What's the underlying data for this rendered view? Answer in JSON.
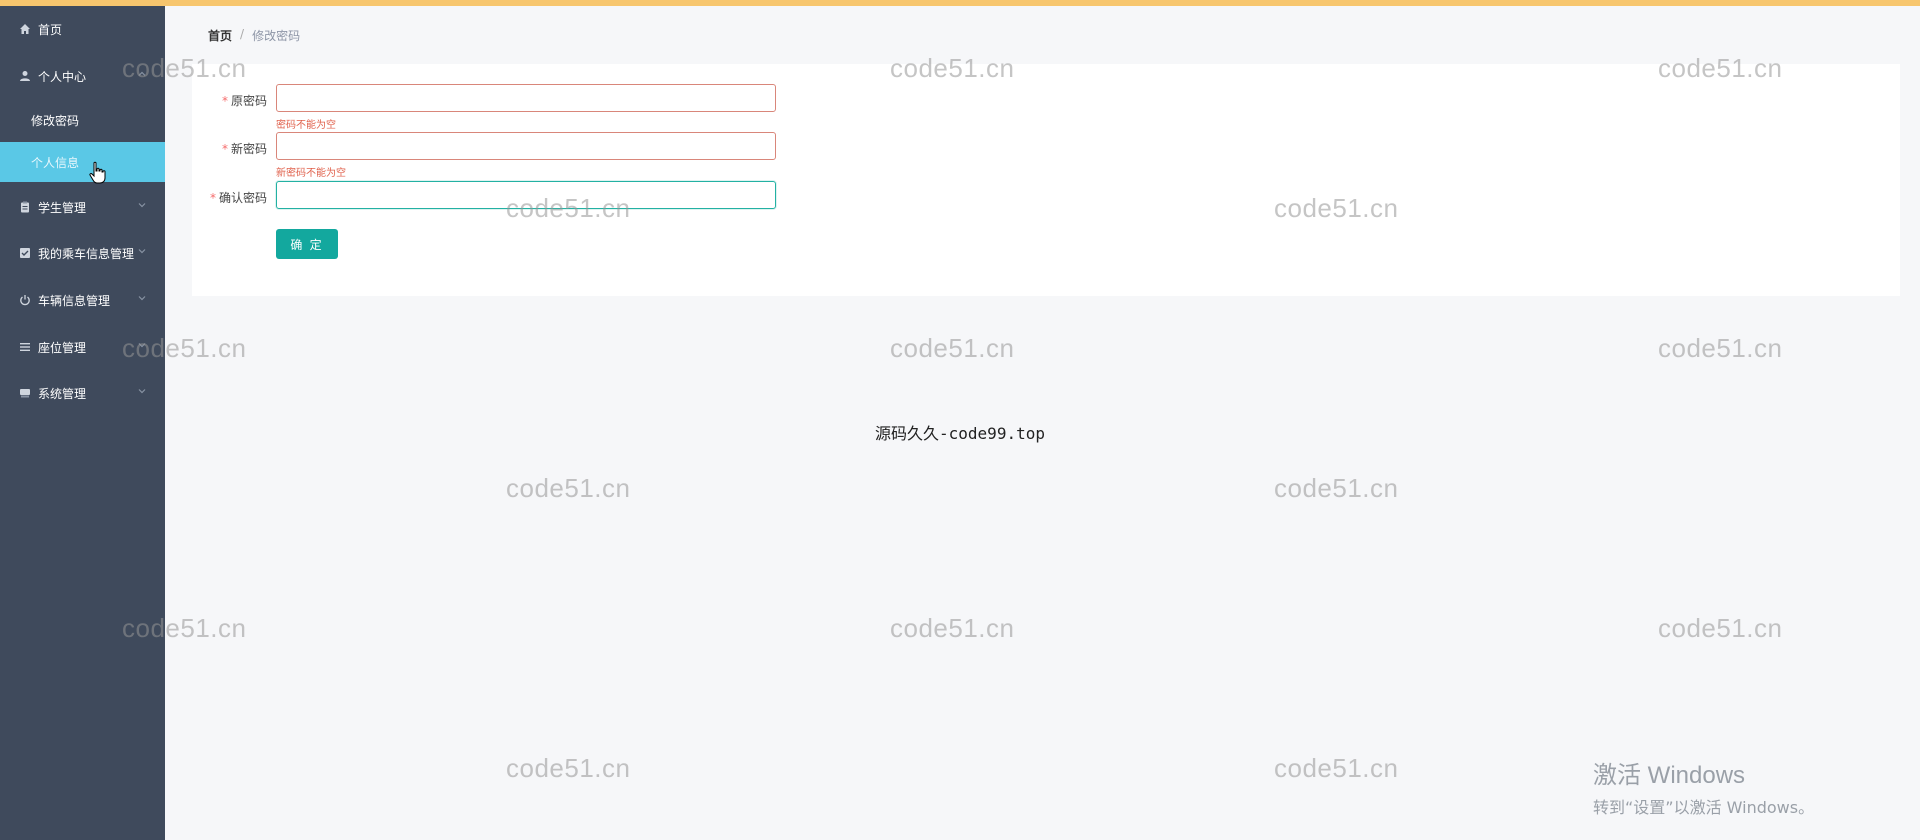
{
  "sidebar": {
    "items": [
      {
        "label": "首页",
        "icon": "home-icon"
      },
      {
        "label": "个人中心",
        "icon": "user-icon"
      },
      {
        "label": "学生管理",
        "icon": "clipboard-icon"
      },
      {
        "label": "我的乘车信息管理",
        "icon": "checkbox-icon"
      },
      {
        "label": "车辆信息管理",
        "icon": "power-icon"
      },
      {
        "label": "座位管理",
        "icon": "list-icon"
      },
      {
        "label": "系统管理",
        "icon": "drawer-icon"
      }
    ],
    "sub_items": [
      {
        "label": "修改密码"
      },
      {
        "label": "个人信息"
      }
    ]
  },
  "breadcrumb": {
    "home": "首页",
    "sep": "/",
    "current": "修改密码"
  },
  "form": {
    "old_password": {
      "label": "原密码",
      "value": "",
      "error": "密码不能为空"
    },
    "new_password": {
      "label": "新密码",
      "value": "",
      "error": "新密码不能为空"
    },
    "confirm_password": {
      "label": "确认密码",
      "value": ""
    },
    "required_mark": "*",
    "submit_label": "确 定"
  },
  "center_text": {
    "zh": "源码久久",
    "en": "-code99.top"
  },
  "watermark": "code51.cn",
  "activate_windows": {
    "title": "激活 Windows",
    "subtitle": "转到“设置”以激活 Windows。"
  },
  "colors": {
    "sidebar_bg": "#3f4a5c",
    "active_item": "#5ac8e6",
    "button": "#13a89e",
    "error": "#e0624d",
    "top_bar": "#f7c66e"
  }
}
